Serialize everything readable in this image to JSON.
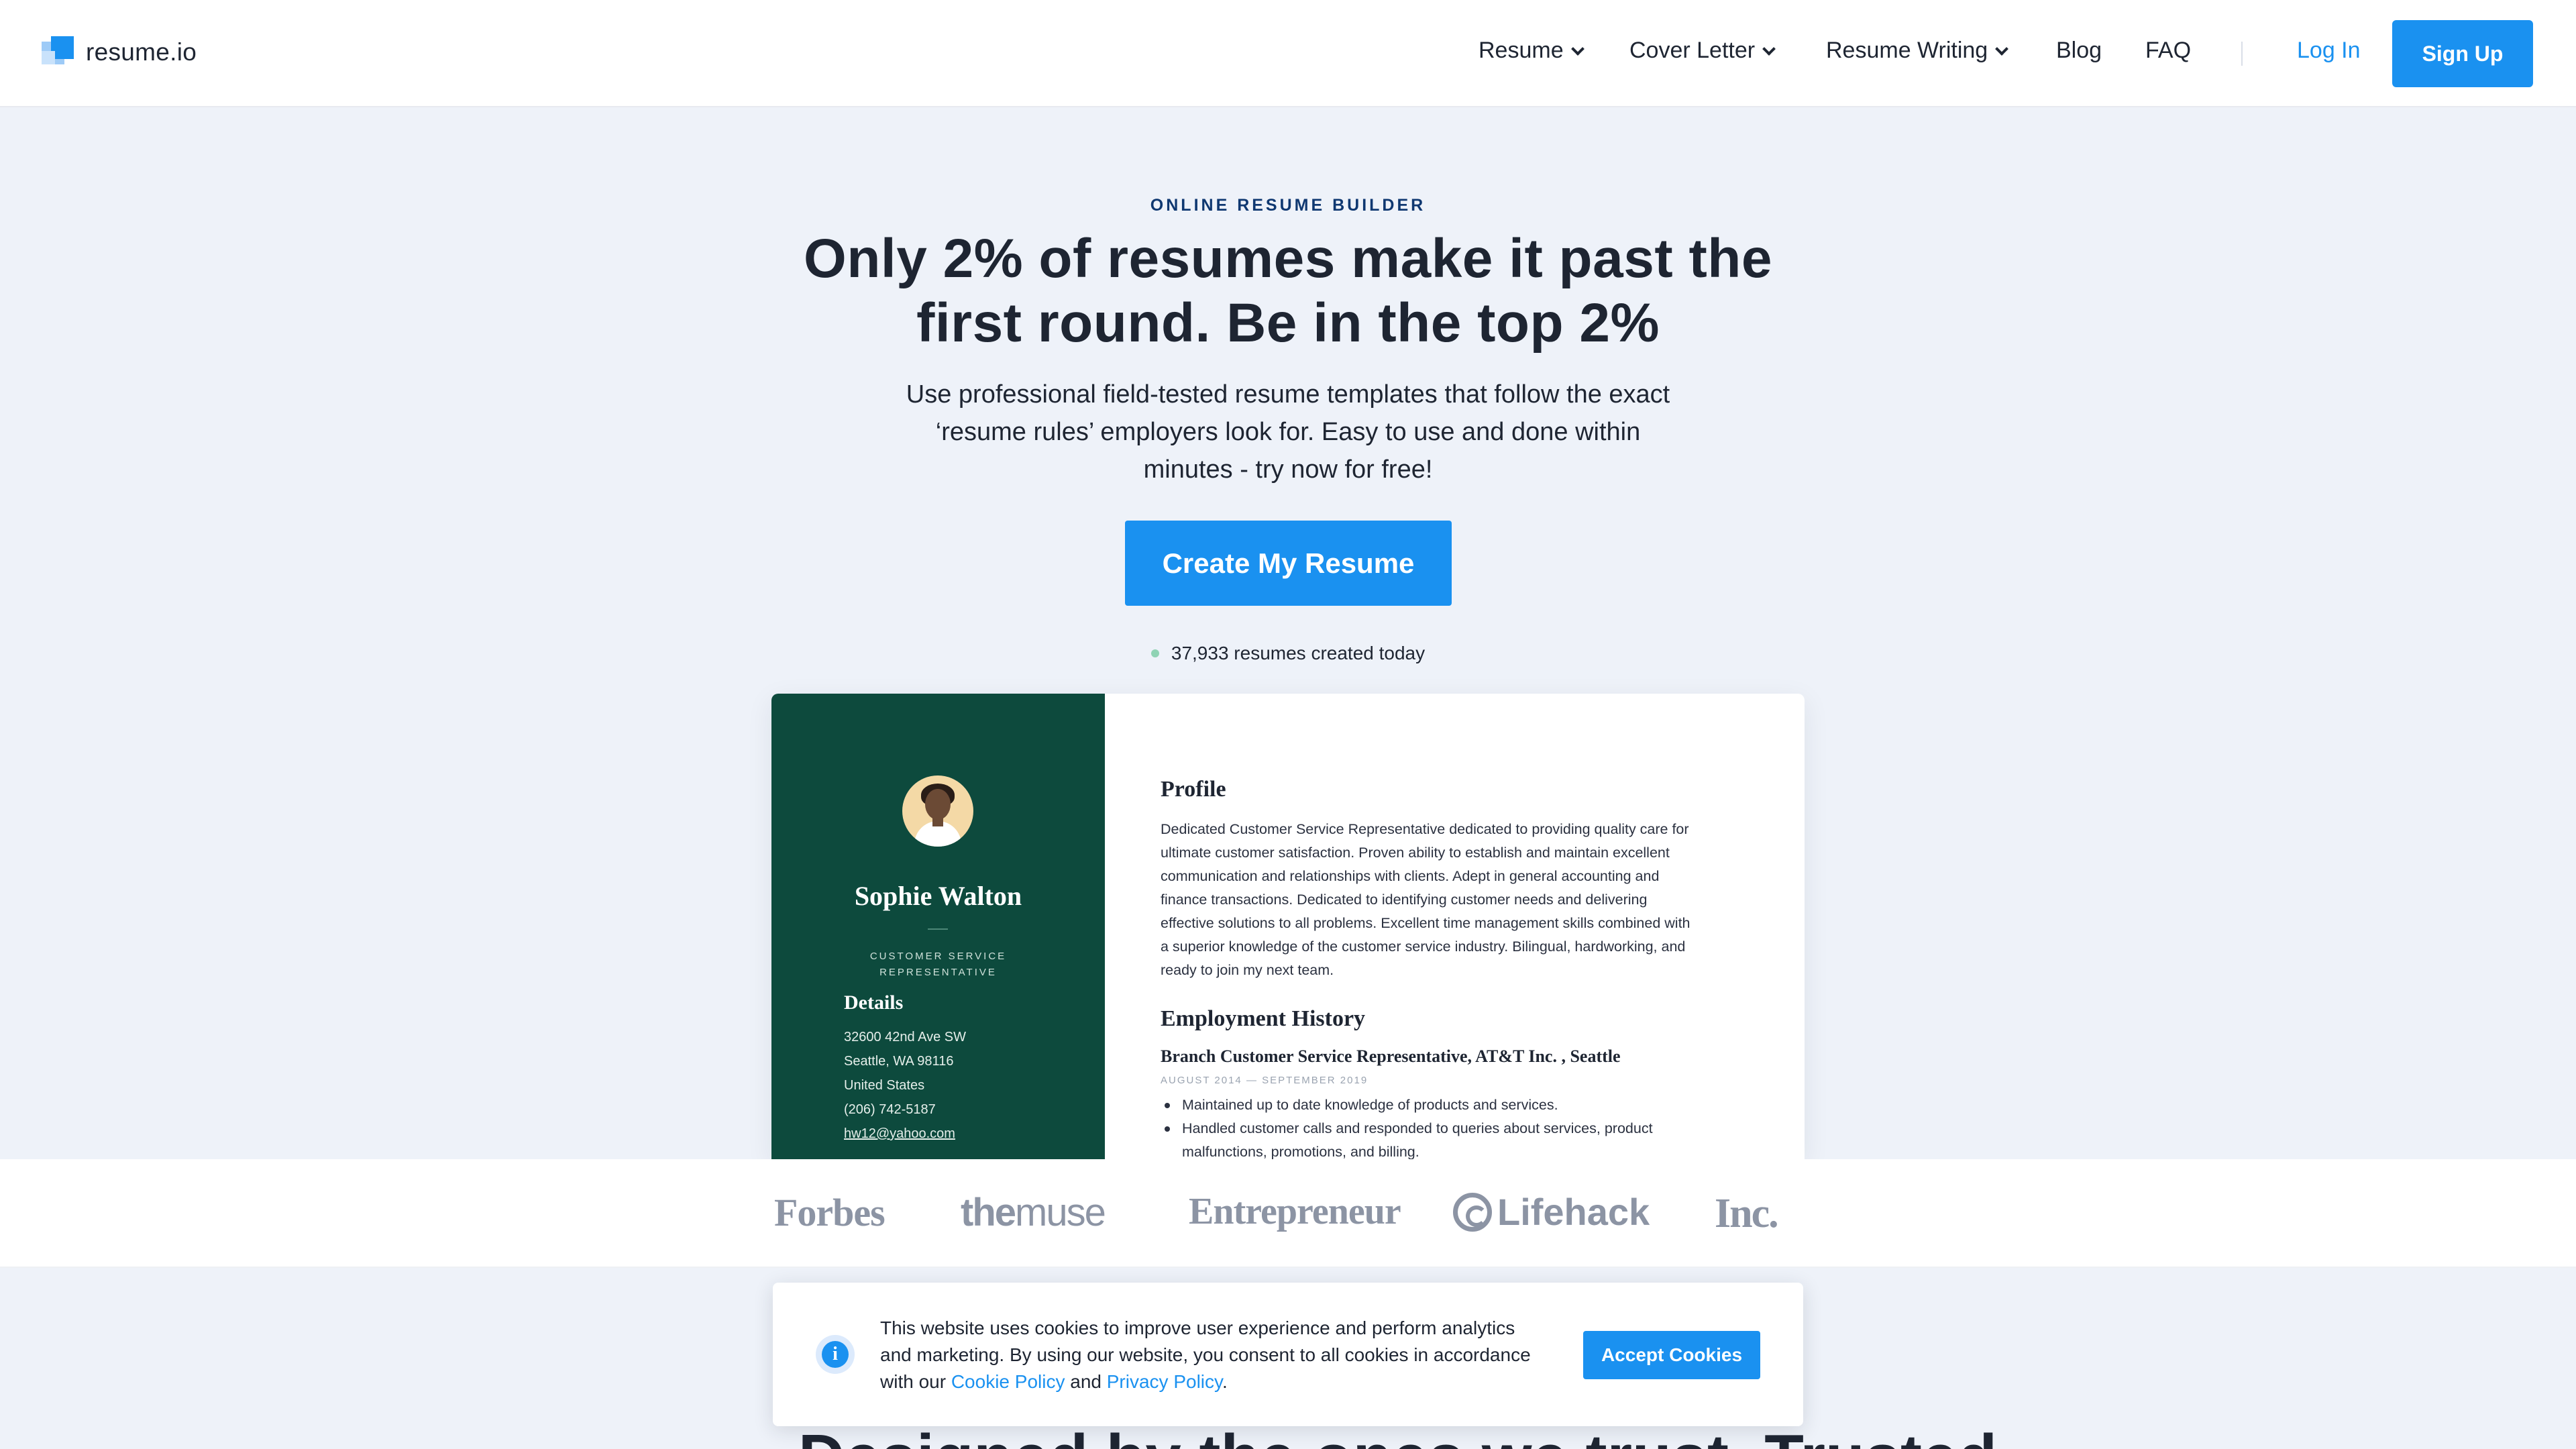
{
  "header": {
    "logo_text": "resume.io",
    "nav": [
      {
        "label": "Resume",
        "dropdown": true
      },
      {
        "label": "Cover Letter",
        "dropdown": true
      },
      {
        "label": "Resume Writing",
        "dropdown": true
      },
      {
        "label": "Blog",
        "dropdown": false
      },
      {
        "label": "FAQ",
        "dropdown": false
      }
    ],
    "login_label": "Log In",
    "signup_label": "Sign Up"
  },
  "hero": {
    "eyebrow": "ONLINE RESUME BUILDER",
    "headline_line1": "Only 2% of resumes make it past the",
    "headline_line2": "first round. Be in the top 2%",
    "subtext_line1": "Use professional field-tested resume templates that follow the exact",
    "subtext_line2": "‘resume rules’ employers look for. Easy to use and done within",
    "subtext_line3": "minutes - try now for free!",
    "cta_label": "Create My Resume",
    "counter_text": "37,933 resumes created today"
  },
  "resume_preview": {
    "name": "Sophie Walton",
    "title_line1": "CUSTOMER SERVICE",
    "title_line2": "REPRESENTATIVE",
    "details_heading": "Details",
    "details": {
      "address1": "32600 42nd Ave SW",
      "address2": "Seattle, WA 98116",
      "country": "United States",
      "phone": "(206) 742-5187",
      "email": "hw12@yahoo.com"
    },
    "profile_heading": "Profile",
    "profile_lines": [
      "Dedicated Customer Service Representative dedicated to providing quality care for",
      "ultimate customer satisfaction. Proven ability to establish and maintain excellent",
      "communication and relationships with clients. Adept in general accounting and",
      "finance transactions. Dedicated to identifying customer needs and delivering",
      "effective solutions to all problems. Excellent time management skills combined with",
      "a superior knowledge of the customer service industry. Bilingual, hardworking, and",
      "ready to join my next team."
    ],
    "employment_heading": "Employment History",
    "job_title": "Branch Customer Service Representative, AT&T Inc. , Seattle",
    "job_dates": "AUGUST 2014 — SEPTEMBER 2019",
    "job_bullets": [
      "Maintained up to date knowledge of products and services.",
      "Handled customer calls and responded to queries about services, product",
      "malfunctions, promotions, and billing."
    ]
  },
  "press": {
    "forbes": "Forbes",
    "muse_a": "the",
    "muse_b": "muse",
    "entrepreneur": "Entrepreneur",
    "lifehack": "Lifehack",
    "inc": "Inc."
  },
  "cookie": {
    "text_line1": "This website uses cookies to improve user experience and perform analytics",
    "text_line2": "and marketing. By using our website, you consent to all cookies in accordance",
    "text_line3_a": "with our ",
    "cookie_policy": "Cookie Policy",
    "and": " and ",
    "privacy_policy": "Privacy Policy",
    "period": ".",
    "accept_label": "Accept Cookies"
  },
  "next_section": {
    "heading_partial": "Designed by the ones we trust. Trusted"
  },
  "colors": {
    "accent": "#1a91f0",
    "hero_bg": "#eef2f9",
    "resume_sidebar": "#0d4a3d"
  }
}
